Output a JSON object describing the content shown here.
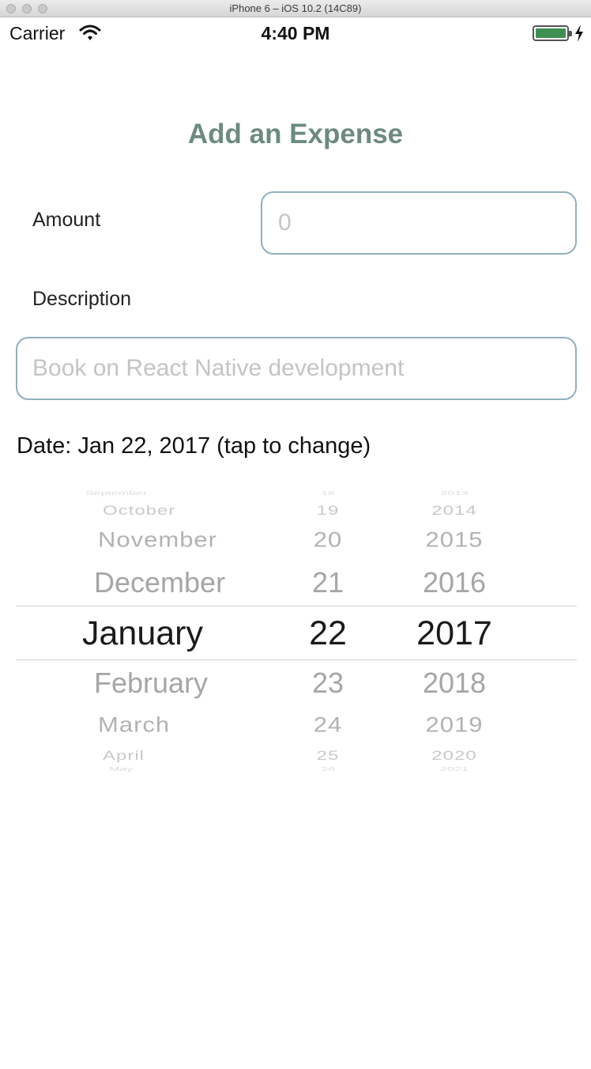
{
  "window": {
    "title": "iPhone 6 – iOS 10.2 (14C89)"
  },
  "status_bar": {
    "carrier": "Carrier",
    "time": "4:40 PM",
    "battery_color": "#3f8f52"
  },
  "form": {
    "title": "Add an Expense",
    "title_color": "#6c8b7e",
    "amount_label": "Amount",
    "amount_placeholder": "0",
    "description_label": "Description",
    "description_placeholder": "Book on React Native development",
    "date_text": "Date: Jan 22, 2017 (tap to change)",
    "input_border_color": "#8fb0bd"
  },
  "date_picker": {
    "months": [
      "September",
      "October",
      "November",
      "December",
      "January",
      "February",
      "March",
      "April",
      "May"
    ],
    "days": [
      "18",
      "19",
      "20",
      "21",
      "22",
      "23",
      "24",
      "25",
      "26"
    ],
    "years": [
      "2013",
      "2014",
      "2015",
      "2016",
      "2017",
      "2018",
      "2019",
      "2020",
      "2021"
    ],
    "selected": {
      "month": "January",
      "day": "22",
      "year": "2017"
    }
  }
}
